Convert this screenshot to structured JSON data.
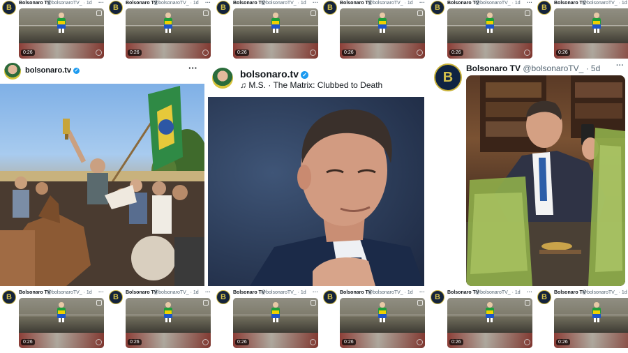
{
  "tile": {
    "name": "Bolsonaro TV",
    "handle": "@bolsonaroTV_ · 1d",
    "duration": "0:26",
    "avatar_letter": "B",
    "more": "···"
  },
  "post_left": {
    "name": "bolsonaro.tv",
    "verified": "✓",
    "more": "···"
  },
  "post_center": {
    "name": "bolsonaro.tv",
    "verified": "✓",
    "music_icon": "♫",
    "song": "M.S. · The Matrix: Clubbed to Death"
  },
  "post_right": {
    "name": "Bolsonaro TV",
    "handle": "@bolsonaroTV_ · 5d",
    "avatar_letter": "B",
    "more": "···"
  },
  "colors": {
    "brand_navy": "#0f2342",
    "brand_gold": "#c9b23a",
    "verified_blue": "#1d9bf0"
  }
}
